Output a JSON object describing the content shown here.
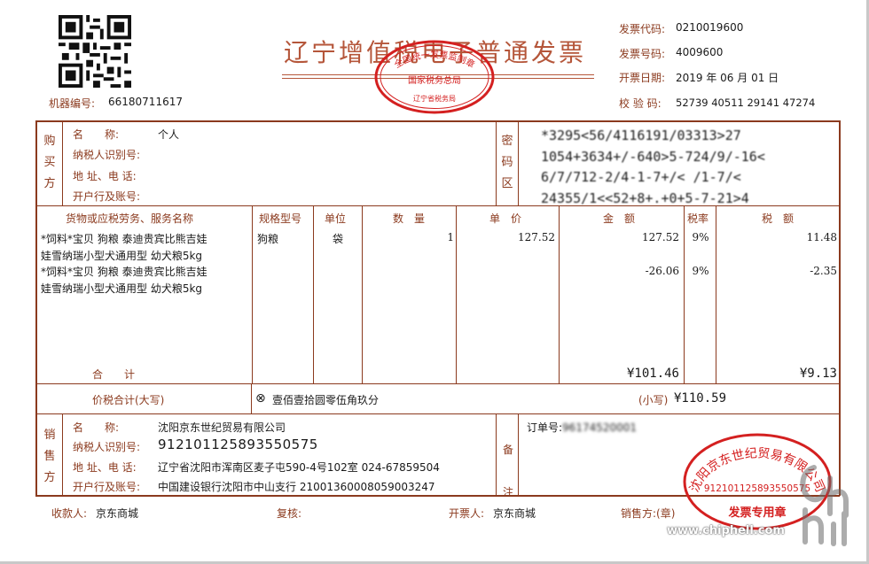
{
  "header": {
    "title": "辽宁增值税电子普通发票",
    "invoice_code_label": "发票代码:",
    "invoice_code": "0210019600",
    "invoice_no_label": "发票号码:",
    "invoice_no": "4009600",
    "date_label": "开票日期:",
    "date": "2019 年 06 月 01 日",
    "check_label": "校 验 码:",
    "check_code": "52739 40511 29141 47274",
    "machine_label": "机器编号:",
    "machine_no": "66180711617"
  },
  "buyer": {
    "section_label": "购买方",
    "name_label": "名　　称:",
    "name": "个人",
    "tax_id_label": "纳税人识别号:",
    "address_label": "地 址、电 话:",
    "bank_label": "开户行及账号:"
  },
  "cipher": {
    "section_label": "密码区",
    "lines": [
      "*3295<56/4116191/03313>27",
      "1054+3634+/-640>5-724/9/-16<",
      "6/7/712-2/4-1-7+/< /1-7/<",
      "24355/1<<52+8+.+0+5-7-21>4"
    ]
  },
  "items": {
    "headers": {
      "name": "货物或应税劳务、服务名称",
      "spec": "规格型号",
      "unit": "单位",
      "qty": "数　量",
      "price": "单　价",
      "amount": "金　额",
      "rate": "税率",
      "tax": "税　额"
    },
    "rows": [
      {
        "name_line1": "*饲料*宝贝 狗粮 泰迪贵宾比熊吉娃",
        "name_line2": "娃雪纳瑞小型犬通用型 幼犬粮5kg",
        "spec": "狗粮",
        "unit": "袋",
        "qty": "1",
        "price": "127.52",
        "amount": "127.52",
        "rate": "9%",
        "tax": "11.48"
      },
      {
        "name_line1": "*饲料*宝贝 狗粮 泰迪贵宾比熊吉娃",
        "name_line2": "娃雪纳瑞小型犬通用型 幼犬粮5kg",
        "spec": "",
        "unit": "",
        "qty": "",
        "price": "",
        "amount": "-26.06",
        "rate": "9%",
        "tax": "-2.35"
      }
    ],
    "total_label": "合　　计",
    "total_amount": "¥101.46",
    "total_tax": "¥9.13"
  },
  "sum": {
    "label": "价税合计(大写)",
    "upper": "壹佰壹拾圆零伍角玖分",
    "small_label": "(小写)",
    "small": "¥110.59"
  },
  "seller": {
    "section_label": "销售方",
    "name_label": "名　　称:",
    "name": "沈阳京东世纪贸易有限公司",
    "tax_id_label": "纳税人识别号:",
    "tax_id": "912101125893550575",
    "address_label": "地 址、电 话:",
    "address": "辽宁省沈阳市浑南区麦子屯590-4号102室 024-67859504",
    "bank_label": "开户行及账号:",
    "bank": "中国建设银行沈阳市中山支行 21001360008059003247"
  },
  "remark": {
    "section_label": "备注",
    "order_label": "订单号:",
    "order_no": "96174520001"
  },
  "footer": {
    "payee_label": "收款人:",
    "payee": "京东商城",
    "reviewer_label": "复核:",
    "drawer_label": "开票人:",
    "drawer": "京东商城",
    "seller_seal_label": "销售方:(章)"
  },
  "stamps": {
    "tax_stamp_top": "全国统一发票监制章",
    "tax_stamp_mid": "国家税务总局",
    "tax_stamp_bottom": "辽宁省税务局",
    "seller_stamp_arc": "沈阳京东世纪贸易有限公司",
    "seller_stamp_id": "912101125893550575",
    "seller_stamp_bottom": "发票专用章"
  },
  "watermark": {
    "url": "www.chiphell.com"
  },
  "colors": {
    "frame": "#8b3a1e",
    "stamp": "#d42020",
    "title": "#b5563a"
  }
}
